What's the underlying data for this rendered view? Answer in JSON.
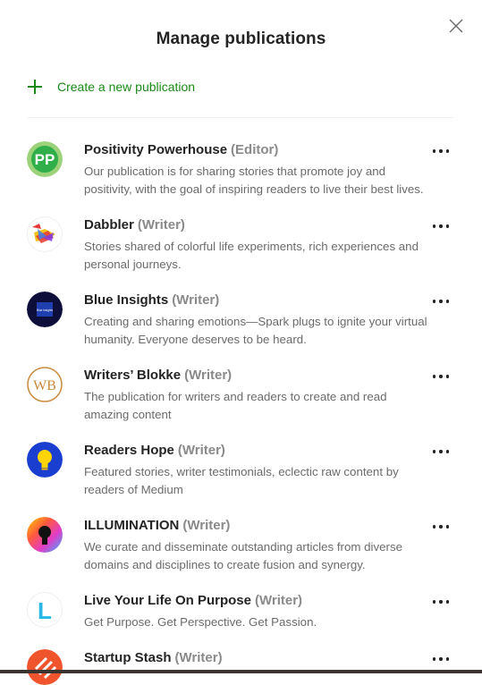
{
  "modal": {
    "title": "Manage publications",
    "create_label": "Create a new publication",
    "close_icon": "close-icon"
  },
  "colors": {
    "accent": "#1a8917",
    "text": "#242424",
    "muted": "#6b6b6b",
    "role": "#8a8a8a"
  },
  "publications": [
    {
      "name": "Positivity Powerhouse",
      "role": "(Editor)",
      "description": "Our publication is for sharing stories that promote joy and positivity, with the goal of inspiring readers to live their best lives.",
      "logo_text": "PP",
      "icon": "more-options-icon"
    },
    {
      "name": "Dabbler",
      "role": "(Writer)",
      "description": "Stories shared of colorful life experiments, rich experiences and personal journeys.",
      "icon": "more-options-icon"
    },
    {
      "name": "Blue Insights",
      "role": "(Writer)",
      "description": "Creating and sharing emotions—Spark plugs to ignite your virtual humanity. Everyone deserves to be heard.",
      "logo_text": "Blue Insights",
      "icon": "more-options-icon"
    },
    {
      "name": "Writers’ Blokke",
      "role": "(Writer)",
      "description": "The publication for writers and readers to create and read amazing content",
      "logo_text": "WB",
      "icon": "more-options-icon"
    },
    {
      "name": "Readers Hope",
      "role": "(Writer)",
      "description": "Featured stories, writer testimonials, eclectic raw content by readers of Medium",
      "icon": "more-options-icon"
    },
    {
      "name": "ILLUMINATION",
      "role": "(Writer)",
      "description": "We curate and disseminate outstanding articles from diverse domains and disciplines to create fusion and synergy.",
      "icon": "more-options-icon"
    },
    {
      "name": "Live Your Life On Purpose",
      "role": "(Writer)",
      "description": "Get Purpose. Get Perspective. Get Passion.",
      "logo_text": "L",
      "icon": "more-options-icon"
    },
    {
      "name": "Startup Stash",
      "role": "(Writer)",
      "description": "",
      "icon": "more-options-icon"
    }
  ]
}
